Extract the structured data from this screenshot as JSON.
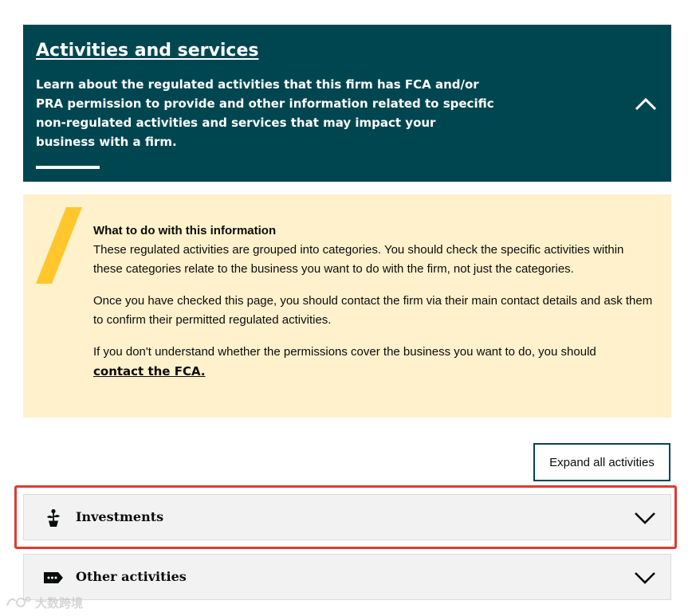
{
  "header": {
    "title": "Activities and services",
    "description": "Learn about the regulated activities that this firm has FCA and/or PRA permission to provide and other information related to specific non-regulated activities and services that may impact your business with a firm.",
    "collapse_icon": "chevron-up-icon",
    "background_color": "#004650"
  },
  "info": {
    "heading": "What to do with this information",
    "paragraph_1": "These regulated activities are grouped into categories. You should check the specific activities within these categories relate to the business you want to do with the firm, not just the categories.",
    "paragraph_2": "Once you have checked this page, you should contact the firm via their main contact details and ask them to confirm their permitted regulated activities.",
    "paragraph_3": "If you don't understand whether the permissions cover the business you want to do, you should",
    "link_label": "contact the FCA.",
    "accent_color": "#ffc72c",
    "background_color": "#fff1cc"
  },
  "expand_all_label": "Expand all activities",
  "accordion": [
    {
      "label": "Investments",
      "icon": "plant-icon",
      "chevron": "chevron-down-icon"
    },
    {
      "label": "Other activities",
      "icon": "tag-icon",
      "chevron": "chevron-down-icon"
    }
  ],
  "highlight_color": "#e03a2f",
  "watermark": {
    "text": "大数跨境",
    "icon": "brand-logo-icon"
  }
}
